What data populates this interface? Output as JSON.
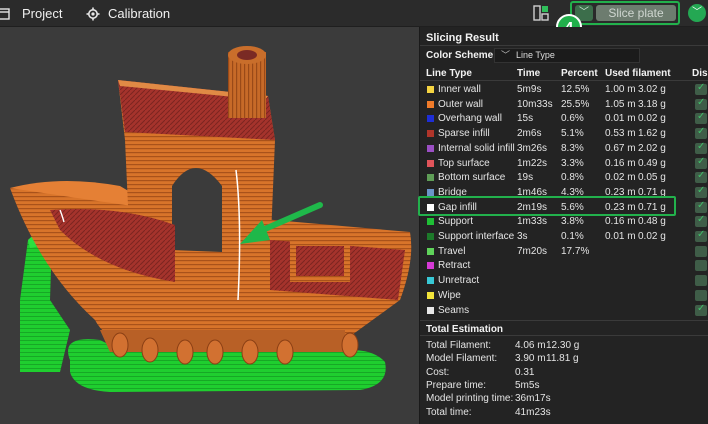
{
  "topbar": {
    "project_label": "Project",
    "calibration_label": "Calibration",
    "slice_button_label": "Slice plate",
    "callout_number": "4",
    "accent_color": "#22b14c"
  },
  "icons": [
    "project-icon",
    "gear-icon",
    "layout-icon",
    "chevron-down-icon",
    "checkbox-checked-icon",
    "arrow-icon"
  ],
  "panel": {
    "title": "Slicing Result",
    "color_scheme_label": "Color Scheme",
    "color_scheme_value": "Line Type",
    "columns": {
      "line_type": "Line Type",
      "time": "Time",
      "percent": "Percent",
      "used_filament": "Used filament",
      "display": "Disp"
    },
    "rows": [
      {
        "name": "Inner wall",
        "time": "5m9s",
        "percent": "12.5%",
        "meters": "1.00 m",
        "grams": "3.02 g",
        "color": "#f5d442",
        "checked": true
      },
      {
        "name": "Outer wall",
        "time": "10m33s",
        "percent": "25.5%",
        "meters": "1.05 m",
        "grams": "3.18 g",
        "color": "#f07b2a",
        "checked": true
      },
      {
        "name": "Overhang wall",
        "time": "15s",
        "percent": "0.6%",
        "meters": "0.01 m",
        "grams": "0.02 g",
        "color": "#1e2ed6",
        "checked": true
      },
      {
        "name": "Sparse infill",
        "time": "2m6s",
        "percent": "5.1%",
        "meters": "0.53 m",
        "grams": "1.62 g",
        "color": "#b0352a",
        "checked": true
      },
      {
        "name": "Internal solid infill",
        "time": "3m26s",
        "percent": "8.3%",
        "meters": "0.67 m",
        "grams": "2.02 g",
        "color": "#9b4fc4",
        "checked": true
      },
      {
        "name": "Top surface",
        "time": "1m22s",
        "percent": "3.3%",
        "meters": "0.16 m",
        "grams": "0.49 g",
        "color": "#e0545a",
        "checked": true
      },
      {
        "name": "Bottom surface",
        "time": "19s",
        "percent": "0.8%",
        "meters": "0.02 m",
        "grams": "0.05 g",
        "color": "#5f9e57",
        "checked": true
      },
      {
        "name": "Bridge",
        "time": "1m46s",
        "percent": "4.3%",
        "meters": "0.23 m",
        "grams": "0.71 g",
        "color": "#6a95c9",
        "checked": true
      },
      {
        "name": "Gap infill",
        "time": "2m19s",
        "percent": "5.6%",
        "meters": "0.23 m",
        "grams": "0.71 g",
        "color": "#ffffff",
        "checked": true
      },
      {
        "name": "Support",
        "time": "1m33s",
        "percent": "3.8%",
        "meters": "0.16 m",
        "grams": "0.48 g",
        "color": "#1fbf35",
        "checked": true
      },
      {
        "name": "Support interface",
        "time": "3s",
        "percent": "0.1%",
        "meters": "0.01 m",
        "grams": "0.02 g",
        "color": "#1d7a2a",
        "checked": true
      },
      {
        "name": "Travel",
        "time": "7m20s",
        "percent": "17.7%",
        "meters": "",
        "grams": "",
        "color": "#5fd35a",
        "checked": false
      },
      {
        "name": "Retract",
        "time": "",
        "percent": "",
        "meters": "",
        "grams": "",
        "color": "#d63ad6",
        "checked": false
      },
      {
        "name": "Unretract",
        "time": "",
        "percent": "",
        "meters": "",
        "grams": "",
        "color": "#38c9d6",
        "checked": false
      },
      {
        "name": "Wipe",
        "time": "",
        "percent": "",
        "meters": "",
        "grams": "",
        "color": "#f2e43a",
        "checked": false
      },
      {
        "name": "Seams",
        "time": "",
        "percent": "",
        "meters": "",
        "grams": "",
        "color": "#e8e8e8",
        "checked": true
      }
    ],
    "highlighted_row": "Gap infill",
    "total_estimation": {
      "title": "Total Estimation",
      "items": [
        {
          "label": "Total Filament:",
          "value": "4.06 m",
          "value2": "12.30 g"
        },
        {
          "label": "Model Filament:",
          "value": "3.90 m",
          "value2": "11.81 g"
        },
        {
          "label": "Cost:",
          "value": "0.31",
          "value2": ""
        },
        {
          "label": "Prepare time:",
          "value": "5m5s",
          "value2": ""
        },
        {
          "label": "Model printing time:",
          "value": "36m17s",
          "value2": ""
        },
        {
          "label": "Total time:",
          "value": "41m23s",
          "value2": ""
        }
      ]
    }
  }
}
